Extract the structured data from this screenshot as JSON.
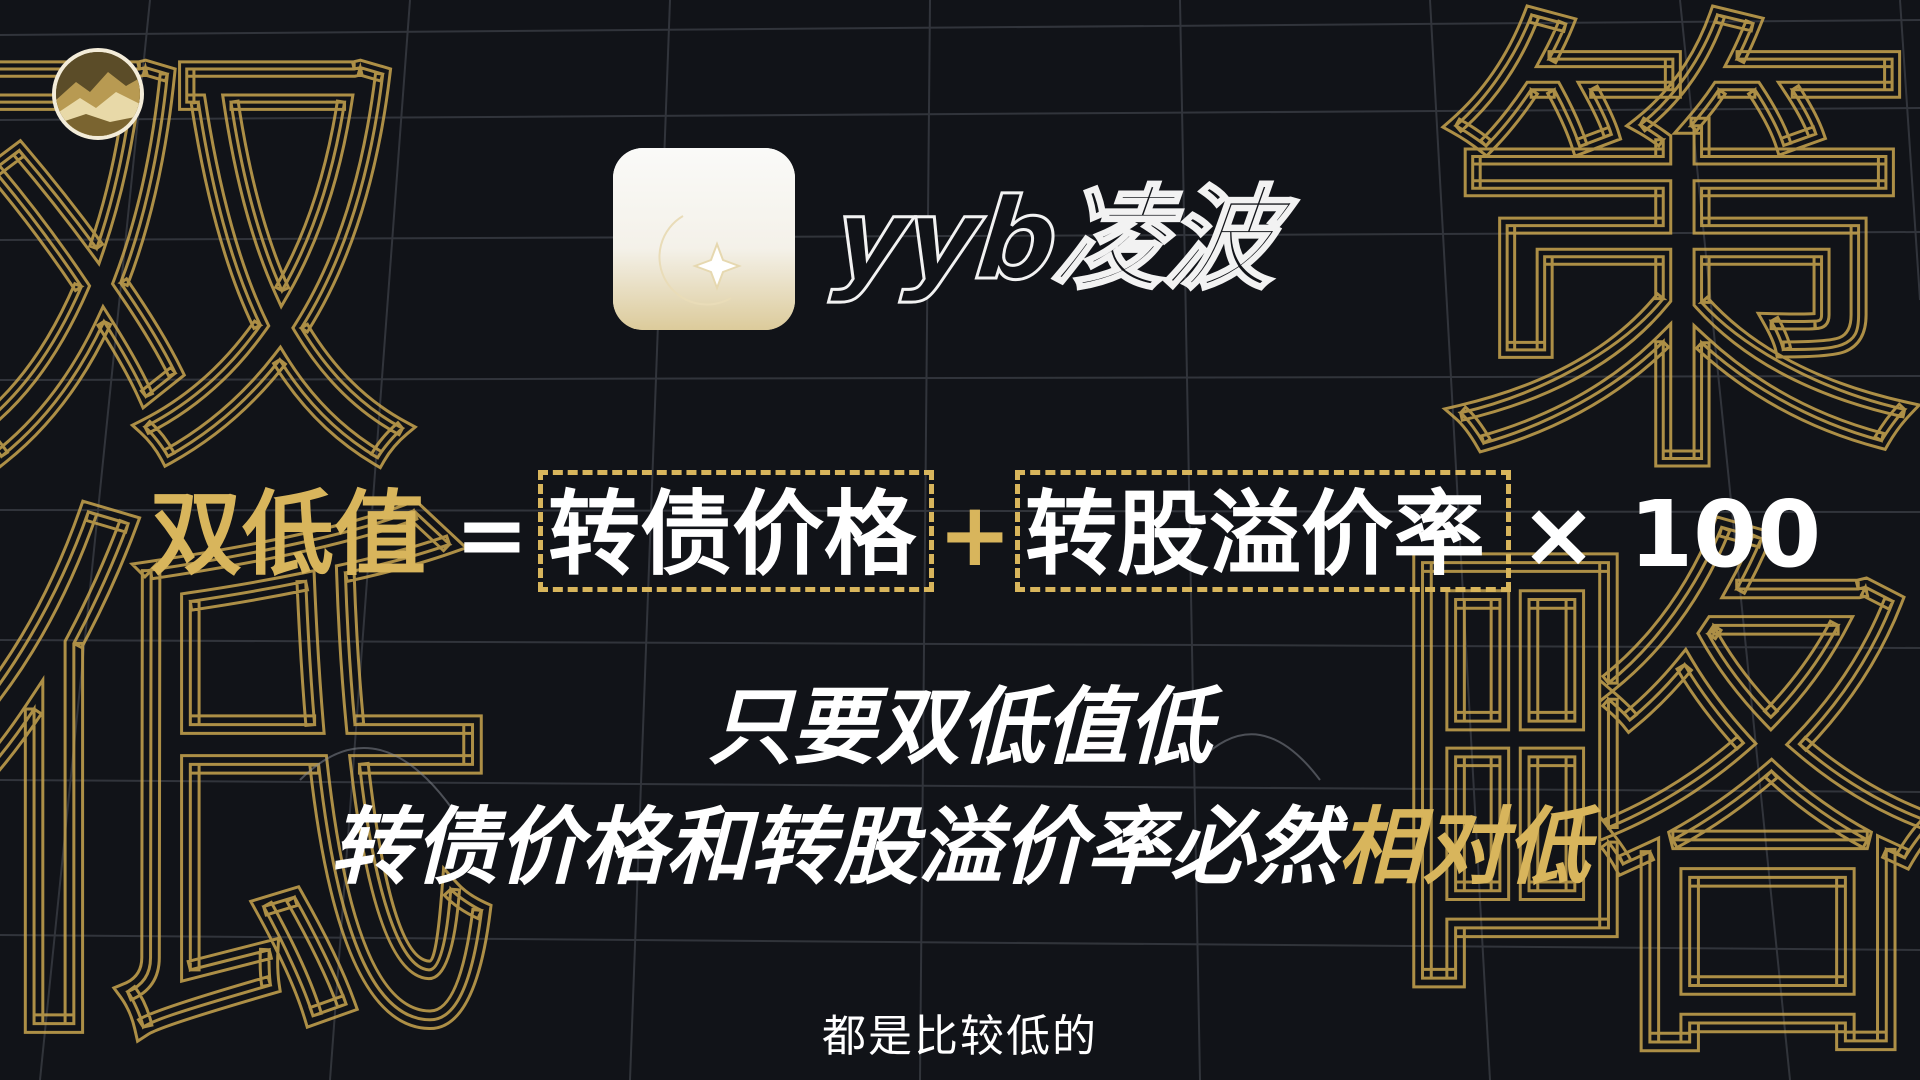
{
  "channel": {
    "avatar_icon": "mountain-avatar-icon"
  },
  "brand": {
    "icon": "moon-star-app-icon",
    "name": "yyb凌波"
  },
  "formula": {
    "term": "双低值",
    "equals": "=",
    "part1": "转债价格",
    "plus": "+",
    "part2": "转股溢价率",
    "times": "× 100"
  },
  "explanation": {
    "line1": "只要双低值低",
    "line2_prefix": "转债价格和转股溢价率必然",
    "line2_highlight": "相对低"
  },
  "subtitle": "都是比较低的",
  "background_glyphs": [
    "双",
    "低",
    "策",
    "略"
  ],
  "colors": {
    "background": "#111318",
    "accent": "#d8b55c",
    "text": "#ffffff"
  }
}
